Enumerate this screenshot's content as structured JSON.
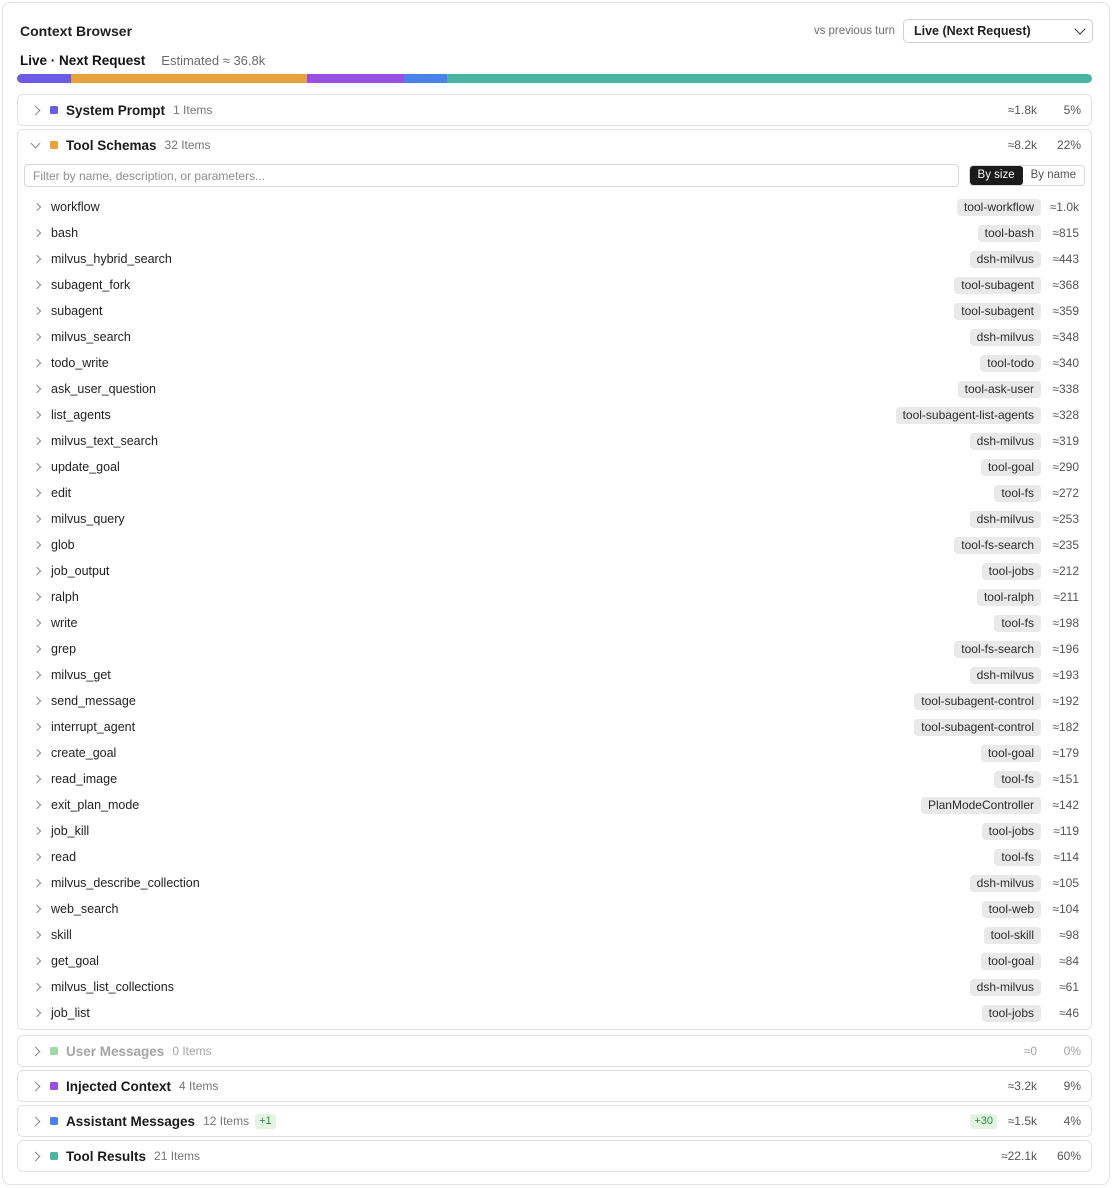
{
  "app": {
    "title": "Context Browser",
    "compare_label": "vs previous turn",
    "select_value": "Live (Next Request)",
    "mode_label": "Live · Next Request",
    "estimate": "Estimated ≈ 36.8k"
  },
  "usage_bar": [
    {
      "name": "System Prompt",
      "percent": 5,
      "color": "#6b5ce7"
    },
    {
      "name": "Tool Schemas",
      "percent": 22,
      "color": "#e8a23c"
    },
    {
      "name": "User Messages",
      "percent": 0,
      "color": "#9fd9a6"
    },
    {
      "name": "Injected Context",
      "percent": 9,
      "color": "#9a4fe4"
    },
    {
      "name": "Assistant Messages",
      "percent": 4,
      "color": "#4b82ea"
    },
    {
      "name": "Tool Results",
      "percent": 60,
      "color": "#4db6a3"
    }
  ],
  "sections": {
    "system_prompt": {
      "title": "System Prompt",
      "count": "1 Items",
      "tokens": "≈1.8k",
      "pct": "5%",
      "color": "#6b5ce7"
    },
    "tool_schemas": {
      "title": "Tool Schemas",
      "count": "32 Items",
      "tokens": "≈8.2k",
      "pct": "22%",
      "color": "#e8a23c"
    },
    "user_messages": {
      "title": "User Messages",
      "count": "0 Items",
      "tokens": "≈0",
      "pct": "0%",
      "color": "#9fd9a6"
    },
    "injected_context": {
      "title": "Injected Context",
      "count": "4 Items",
      "tokens": "≈3.2k",
      "pct": "9%",
      "color": "#9a4fe4"
    },
    "assistant_messages": {
      "title": "Assistant Messages",
      "count": "12 Items",
      "new_badge": "+1",
      "delta": "+30",
      "tokens": "≈1.5k",
      "pct": "4%",
      "color": "#4b82ea"
    },
    "tool_results": {
      "title": "Tool Results",
      "count": "21 Items",
      "tokens": "≈22.1k",
      "pct": "60%",
      "color": "#4db6a3"
    }
  },
  "filter": {
    "placeholder": "Filter by name, description, or parameters...",
    "sort_by_size": "By size",
    "sort_by_name": "By name"
  },
  "tools": [
    {
      "name": "workflow",
      "tag": "tool-workflow",
      "tokens": "≈1.0k"
    },
    {
      "name": "bash",
      "tag": "tool-bash",
      "tokens": "≈815"
    },
    {
      "name": "milvus_hybrid_search",
      "tag": "dsh-milvus",
      "tokens": "≈443"
    },
    {
      "name": "subagent_fork",
      "tag": "tool-subagent",
      "tokens": "≈368"
    },
    {
      "name": "subagent",
      "tag": "tool-subagent",
      "tokens": "≈359"
    },
    {
      "name": "milvus_search",
      "tag": "dsh-milvus",
      "tokens": "≈348"
    },
    {
      "name": "todo_write",
      "tag": "tool-todo",
      "tokens": "≈340"
    },
    {
      "name": "ask_user_question",
      "tag": "tool-ask-user",
      "tokens": "≈338"
    },
    {
      "name": "list_agents",
      "tag": "tool-subagent-list-agents",
      "tokens": "≈328"
    },
    {
      "name": "milvus_text_search",
      "tag": "dsh-milvus",
      "tokens": "≈319"
    },
    {
      "name": "update_goal",
      "tag": "tool-goal",
      "tokens": "≈290"
    },
    {
      "name": "edit",
      "tag": "tool-fs",
      "tokens": "≈272"
    },
    {
      "name": "milvus_query",
      "tag": "dsh-milvus",
      "tokens": "≈253"
    },
    {
      "name": "glob",
      "tag": "tool-fs-search",
      "tokens": "≈235"
    },
    {
      "name": "job_output",
      "tag": "tool-jobs",
      "tokens": "≈212"
    },
    {
      "name": "ralph",
      "tag": "tool-ralph",
      "tokens": "≈211"
    },
    {
      "name": "write",
      "tag": "tool-fs",
      "tokens": "≈198"
    },
    {
      "name": "grep",
      "tag": "tool-fs-search",
      "tokens": "≈196"
    },
    {
      "name": "milvus_get",
      "tag": "dsh-milvus",
      "tokens": "≈193"
    },
    {
      "name": "send_message",
      "tag": "tool-subagent-control",
      "tokens": "≈192"
    },
    {
      "name": "interrupt_agent",
      "tag": "tool-subagent-control",
      "tokens": "≈182"
    },
    {
      "name": "create_goal",
      "tag": "tool-goal",
      "tokens": "≈179"
    },
    {
      "name": "read_image",
      "tag": "tool-fs",
      "tokens": "≈151"
    },
    {
      "name": "exit_plan_mode",
      "tag": "PlanModeController",
      "tokens": "≈142"
    },
    {
      "name": "job_kill",
      "tag": "tool-jobs",
      "tokens": "≈119"
    },
    {
      "name": "read",
      "tag": "tool-fs",
      "tokens": "≈114"
    },
    {
      "name": "milvus_describe_collection",
      "tag": "dsh-milvus",
      "tokens": "≈105"
    },
    {
      "name": "web_search",
      "tag": "tool-web",
      "tokens": "≈104"
    },
    {
      "name": "skill",
      "tag": "tool-skill",
      "tokens": "≈98"
    },
    {
      "name": "get_goal",
      "tag": "tool-goal",
      "tokens": "≈84"
    },
    {
      "name": "milvus_list_collections",
      "tag": "dsh-milvus",
      "tokens": "≈61"
    },
    {
      "name": "job_list",
      "tag": "tool-jobs",
      "tokens": "≈46"
    }
  ]
}
